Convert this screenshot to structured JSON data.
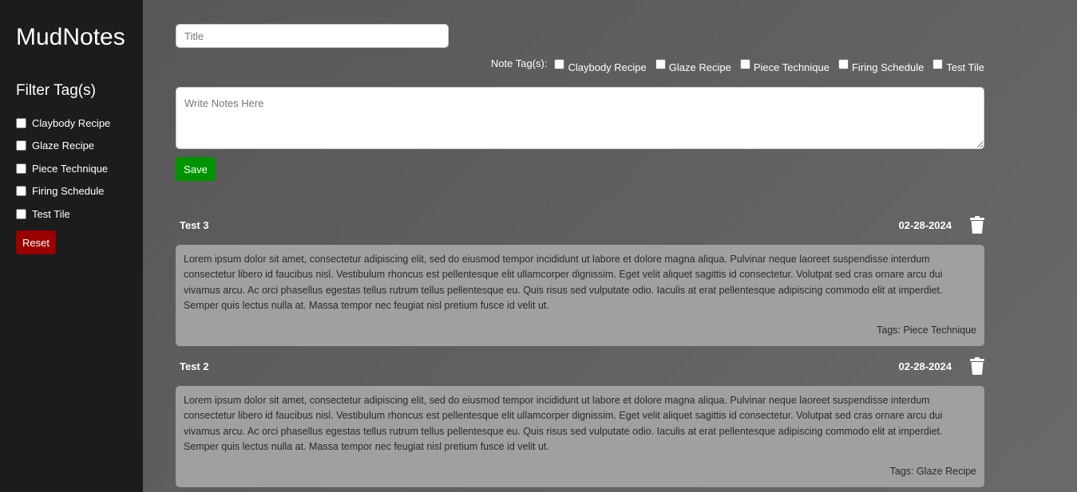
{
  "app": {
    "brand": "MudNotes"
  },
  "sidebar": {
    "filter_heading": "Filter Tag(s)",
    "filters": [
      {
        "label": "Claybody Recipe",
        "checked": false
      },
      {
        "label": "Glaze Recipe",
        "checked": false
      },
      {
        "label": "Piece Technique",
        "checked": false
      },
      {
        "label": "Firing Schedule",
        "checked": false
      },
      {
        "label": "Test Tile",
        "checked": false
      }
    ],
    "reset_label": "Reset"
  },
  "editor": {
    "title_placeholder": "Title",
    "title_value": "",
    "note_tags_label": "Note Tag(s):",
    "tags": [
      {
        "label": "Claybody Recipe",
        "checked": false
      },
      {
        "label": "Glaze Recipe",
        "checked": false
      },
      {
        "label": "Piece Technique",
        "checked": false
      },
      {
        "label": "Firing Schedule",
        "checked": false
      },
      {
        "label": "Test Tile",
        "checked": false
      }
    ],
    "notes_placeholder": "Write Notes Here",
    "notes_value": "",
    "save_label": "Save"
  },
  "notes": [
    {
      "title": "Test 3",
      "date": "02-28-2024",
      "body": "Lorem ipsum dolor sit amet, consectetur adipiscing elit, sed do eiusmod tempor incididunt ut labore et dolore magna aliqua. Pulvinar neque laoreet suspendisse interdum consectetur libero id faucibus nisl. Vestibulum rhoncus est pellentesque elit ullamcorper dignissim. Eget velit aliquet sagittis id consectetur. Volutpat sed cras ornare arcu dui vivamus arcu. Ac orci phasellus egestas tellus rutrum tellus pellentesque eu. Quis risus sed vulputate odio. Iaculis at erat pellentesque adipiscing commodo elit at imperdiet. Semper quis lectus nulla at. Massa tempor nec feugiat nisl pretium fusce id velit ut.",
      "tags": "Tags: Piece Technique"
    },
    {
      "title": "Test 2",
      "date": "02-28-2024",
      "body": "Lorem ipsum dolor sit amet, consectetur adipiscing elit, sed do eiusmod tempor incididunt ut labore et dolore magna aliqua. Pulvinar neque laoreet suspendisse interdum consectetur libero id faucibus nisl. Vestibulum rhoncus est pellentesque elit ullamcorper dignissim. Eget velit aliquet sagittis id consectetur. Volutpat sed cras ornare arcu dui vivamus arcu. Ac orci phasellus egestas tellus rutrum tellus pellentesque eu. Quis risus sed vulputate odio. Iaculis at erat pellentesque adipiscing commodo elit at imperdiet. Semper quis lectus nulla at. Massa tempor nec feugiat nisl pretium fusce id velit ut.",
      "tags": "Tags: Glaze Recipe"
    }
  ],
  "colors": {
    "sidebar_bg": "#1c1c1c",
    "save_button": "#009400",
    "reset_button": "#9b0000",
    "note_card": "#a0a0a0"
  },
  "icons": {
    "delete": "trash-icon"
  }
}
